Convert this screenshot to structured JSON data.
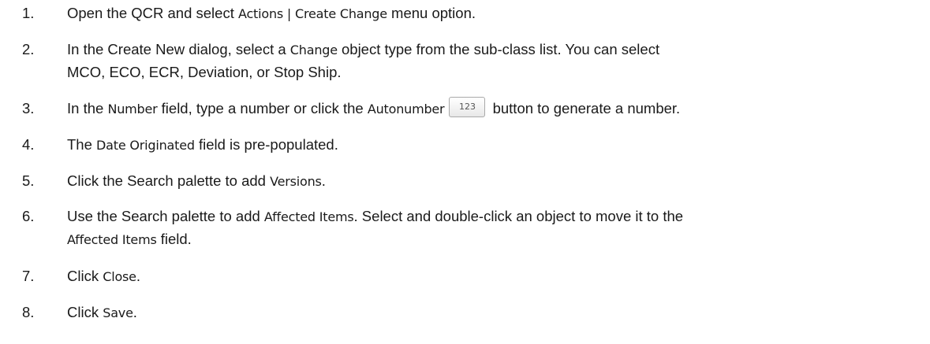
{
  "steps": [
    {
      "num": "1.",
      "a": "Open the QCR and select ",
      "b": "Actions | Create Change",
      "c": " menu option."
    },
    {
      "num": "2.",
      "a": "In the Create New dialog, select a ",
      "b": "Change",
      "c": " object type from the sub-class list. You can select",
      "line2": "MCO, ECO, ECR, Deviation, or Stop Ship."
    },
    {
      "num": "3.",
      "a": "In the ",
      "b": "Number",
      "c": " field, type a number or click the ",
      "d": "Autonumber",
      "button": "123",
      "e": " button to generate a number."
    },
    {
      "num": "4.",
      "a": "The ",
      "b": "Date Originated",
      "c": " field is pre-populated."
    },
    {
      "num": "5.",
      "a": "Click the Search palette to add ",
      "b": "Versions",
      "c": "."
    },
    {
      "num": "6.",
      "a": "Use the Search palette to add ",
      "b": "Affected Items",
      "c": ". Select and double-click an object to move it to the",
      "line2b": "Affected Items",
      "line2c": " field."
    },
    {
      "num": "7.",
      "a": "Click ",
      "b": "Close",
      "c": "."
    },
    {
      "num": "8.",
      "a": "Click ",
      "b": "Save",
      "c": "."
    }
  ]
}
